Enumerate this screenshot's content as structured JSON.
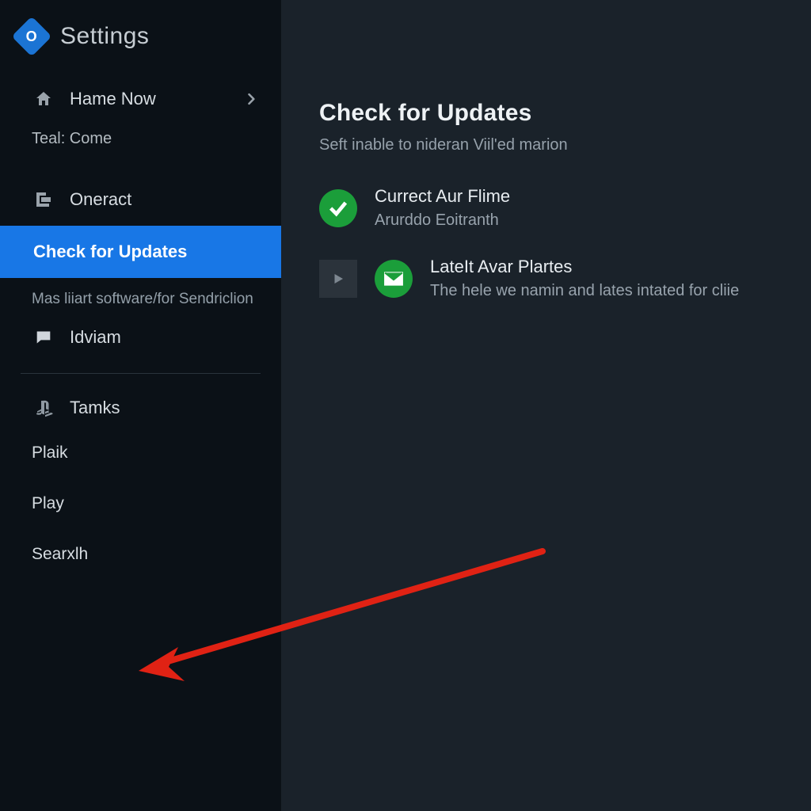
{
  "sidebar": {
    "logo_letter": "O",
    "title": "Settings",
    "item_hame": "Hame Now",
    "teal_come": "Teal: Come",
    "item_oneract": "Oneract",
    "item_updates": "Check for Updates",
    "desc_software": "Mas liiart software/for Sendriclion",
    "item_idviam": "Idviam",
    "item_tamks": "Tamks",
    "item_plaik": "Plaik",
    "item_play": "Play",
    "item_searxlh": "Searxlh"
  },
  "main": {
    "title": "Check for Updates",
    "subtitle": "Seft inable to nideran Viil'ed marion",
    "status_title": "Currect Aur Flime",
    "status_sub": "Arurddo Eoitranth",
    "latest_title": "LateIt Avar Plartes",
    "latest_sub": "The hele we namin and lates intated for cliie"
  }
}
